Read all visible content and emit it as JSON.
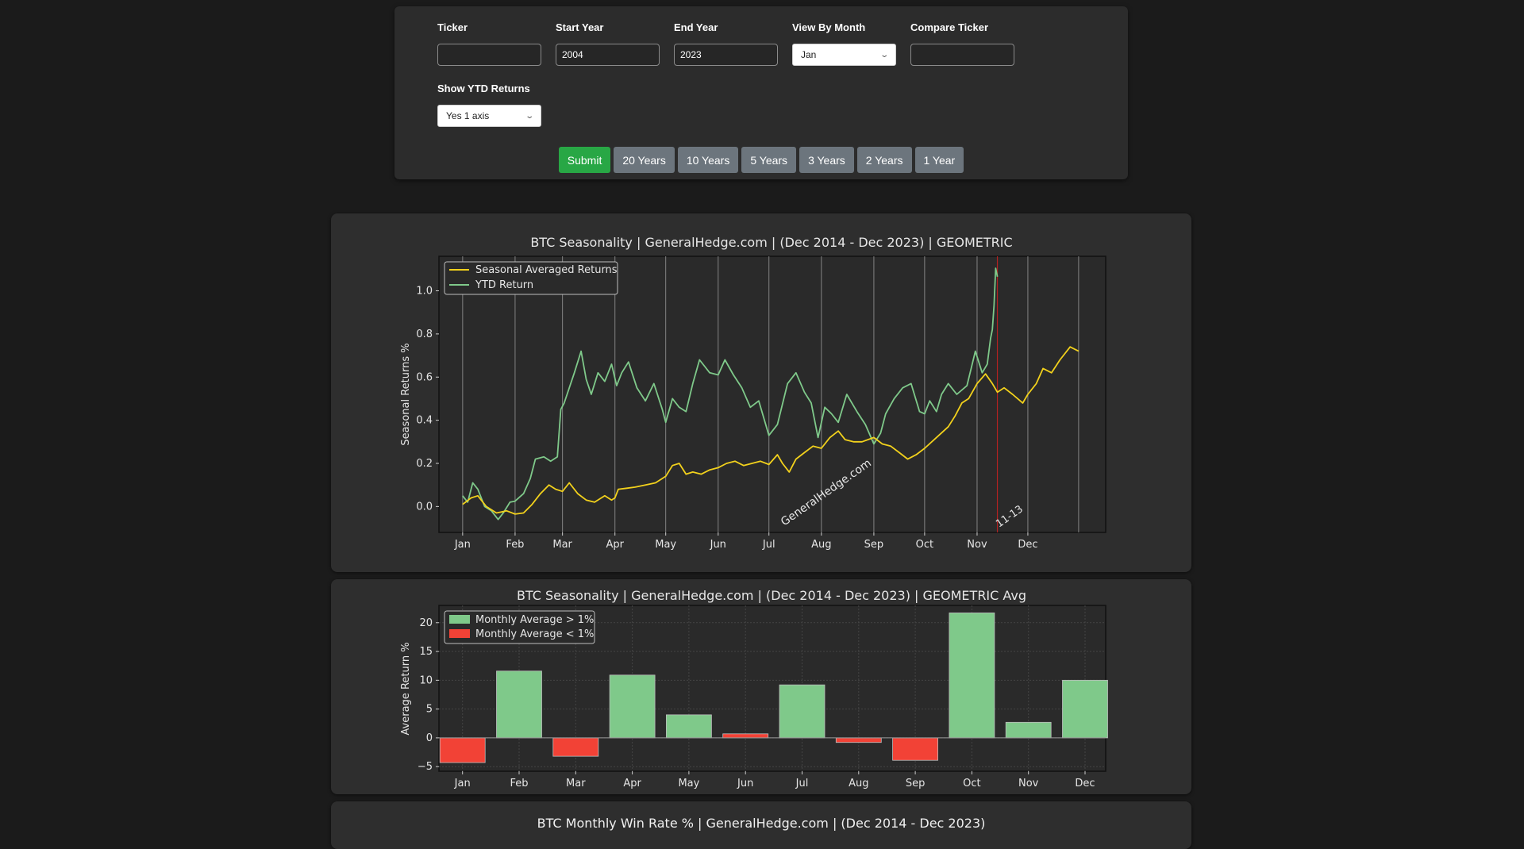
{
  "form": {
    "fields": [
      {
        "label": "Ticker",
        "value": "",
        "type": "text"
      },
      {
        "label": "Start Year",
        "value": "2004",
        "type": "text"
      },
      {
        "label": "End Year",
        "value": "2023",
        "type": "text"
      },
      {
        "label": "View By Month",
        "value": "Jan",
        "type": "select"
      },
      {
        "label": "Compare Ticker",
        "value": "",
        "type": "text"
      }
    ],
    "ytd": {
      "label": "Show YTD Returns",
      "value": "Yes 1 axis"
    },
    "buttons": {
      "submit": "Submit",
      "y20": "20 Years",
      "y10": "10 Years",
      "y5": "5 Years",
      "y3": "3 Years",
      "y2": "2 Years",
      "y1": "1 Year"
    },
    "chevron_icon": "⌄"
  },
  "colors": {
    "submit": "#28a745",
    "preset_button": "#6c757d",
    "seasonal_line": "#f2d11c",
    "ytd_line": "#7fc98a",
    "positive_bar": "#7fc98a",
    "negative_bar": "#f24236",
    "marker_line": "#b22222"
  },
  "chart_data": [
    {
      "type": "line",
      "title": "BTC Seasonality | GeneralHedge.com | (Dec 2014 - Dec 2023) | GEOMETRIC",
      "xlabel": "",
      "ylabel": "Seasonal Returns %",
      "ylim": [
        -0.12,
        1.16
      ],
      "yticks": [
        0.0,
        0.2,
        0.4,
        0.6,
        0.8,
        1.0
      ],
      "ytick_labels": [
        "0.0",
        "0.2",
        "0.4",
        "0.6",
        "0.8",
        "1.0"
      ],
      "xlim_days": [
        -14,
        380
      ],
      "x_unit": "day of year",
      "month_ticks": [
        {
          "label": "Jan",
          "day": 0
        },
        {
          "label": "Feb",
          "day": 31
        },
        {
          "label": "Mar",
          "day": 59
        },
        {
          "label": "Apr",
          "day": 90
        },
        {
          "label": "May",
          "day": 120
        },
        {
          "label": "Jun",
          "day": 151
        },
        {
          "label": "Jul",
          "day": 181
        },
        {
          "label": "Aug",
          "day": 212
        },
        {
          "label": "Sep",
          "day": 243
        },
        {
          "label": "Oct",
          "day": 273
        },
        {
          "label": "Nov",
          "day": 304
        },
        {
          "label": "Dec",
          "day": 334
        }
      ],
      "end_gridline_day": 364,
      "grid": "vertical at month starts",
      "legend": "top-left",
      "watermark": "GeneralHedge.com",
      "marker": {
        "label": "11-13",
        "day": 316
      },
      "series": [
        {
          "name": "Seasonal Averaged Returns",
          "x": [
            0,
            5,
            9,
            14,
            20,
            26,
            31,
            36,
            41,
            46,
            51,
            55,
            59,
            63,
            68,
            73,
            78,
            84,
            88,
            90,
            92,
            97,
            102,
            108,
            114,
            120,
            124,
            128,
            132,
            136,
            141,
            146,
            151,
            156,
            161,
            166,
            171,
            176,
            181,
            186,
            189,
            193,
            197,
            202,
            207,
            212,
            217,
            222,
            226,
            231,
            236,
            243,
            248,
            253,
            258,
            263,
            268,
            273,
            280,
            287,
            291,
            295,
            299,
            304,
            309,
            313,
            316,
            320,
            325,
            331,
            334,
            339,
            343,
            348,
            353,
            359,
            364
          ],
          "values": [
            0.01,
            0.04,
            0.05,
            0.0,
            -0.03,
            -0.02,
            -0.035,
            -0.03,
            0.01,
            0.06,
            0.1,
            0.08,
            0.07,
            0.11,
            0.06,
            0.03,
            0.02,
            0.05,
            0.03,
            0.04,
            0.08,
            0.085,
            0.09,
            0.1,
            0.11,
            0.14,
            0.19,
            0.2,
            0.15,
            0.16,
            0.15,
            0.17,
            0.18,
            0.2,
            0.21,
            0.19,
            0.2,
            0.21,
            0.195,
            0.24,
            0.2,
            0.16,
            0.22,
            0.25,
            0.28,
            0.27,
            0.32,
            0.35,
            0.31,
            0.3,
            0.3,
            0.32,
            0.29,
            0.28,
            0.25,
            0.22,
            0.24,
            0.27,
            0.32,
            0.37,
            0.42,
            0.48,
            0.5,
            0.57,
            0.615,
            0.57,
            0.53,
            0.55,
            0.52,
            0.48,
            0.52,
            0.57,
            0.64,
            0.62,
            0.68,
            0.74,
            0.72
          ]
        },
        {
          "name": "YTD Return",
          "x": [
            0,
            3,
            6,
            9,
            13,
            17,
            21,
            24,
            28,
            31,
            36,
            40,
            43,
            48,
            52,
            56,
            58,
            60,
            63,
            66,
            70,
            73,
            76,
            80,
            84,
            88,
            91,
            94,
            98,
            103,
            108,
            113,
            118,
            120,
            124,
            128,
            132,
            136,
            140,
            146,
            151,
            155,
            160,
            165,
            170,
            175,
            181,
            186,
            192,
            197,
            202,
            206,
            210,
            214,
            218,
            222,
            227,
            233,
            238,
            243,
            247,
            250,
            255,
            260,
            265,
            270,
            273,
            276,
            280,
            283,
            287,
            292,
            298,
            303,
            307,
            310,
            312,
            313,
            314,
            315,
            316
          ],
          "values": [
            0.05,
            0.02,
            0.11,
            0.08,
            0.0,
            -0.02,
            -0.06,
            -0.03,
            0.02,
            0.025,
            0.06,
            0.13,
            0.22,
            0.23,
            0.21,
            0.23,
            0.45,
            0.48,
            0.55,
            0.62,
            0.72,
            0.59,
            0.52,
            0.62,
            0.58,
            0.66,
            0.56,
            0.62,
            0.67,
            0.55,
            0.49,
            0.57,
            0.45,
            0.39,
            0.5,
            0.46,
            0.44,
            0.57,
            0.68,
            0.62,
            0.61,
            0.68,
            0.61,
            0.55,
            0.46,
            0.49,
            0.33,
            0.38,
            0.57,
            0.62,
            0.53,
            0.48,
            0.32,
            0.46,
            0.43,
            0.39,
            0.52,
            0.44,
            0.38,
            0.29,
            0.34,
            0.43,
            0.5,
            0.55,
            0.57,
            0.44,
            0.43,
            0.49,
            0.44,
            0.52,
            0.57,
            0.52,
            0.56,
            0.72,
            0.62,
            0.66,
            0.78,
            0.82,
            0.93,
            1.105,
            1.065
          ]
        }
      ]
    },
    {
      "type": "bar",
      "title": "BTC Seasonality | GeneralHedge.com | (Dec 2014 - Dec 2023) | GEOMETRIC Avg",
      "xlabel": "",
      "ylabel": "Average Return %",
      "ylim": [
        -5.8,
        23
      ],
      "yticks": [
        -5,
        0,
        5,
        10,
        15,
        20
      ],
      "ytick_labels": [
        "−5",
        "0",
        "5",
        "10",
        "15",
        "20"
      ],
      "categories": [
        "Jan",
        "Feb",
        "Mar",
        "Apr",
        "May",
        "Jun",
        "Jul",
        "Aug",
        "Sep",
        "Oct",
        "Nov",
        "Dec"
      ],
      "values": [
        -4.3,
        11.6,
        -3.2,
        10.9,
        4.0,
        0.7,
        9.2,
        -0.8,
        -3.9,
        21.7,
        2.7,
        10.0
      ],
      "threshold": 1,
      "grid": true,
      "legend": "top-left",
      "legend_entries": [
        "Monthly Average > 1%",
        "Monthly Average < 1%"
      ]
    },
    {
      "type": "bar",
      "title": "BTC Monthly Win Rate % | GeneralHedge.com | (Dec 2014 - Dec 2023)"
    }
  ]
}
